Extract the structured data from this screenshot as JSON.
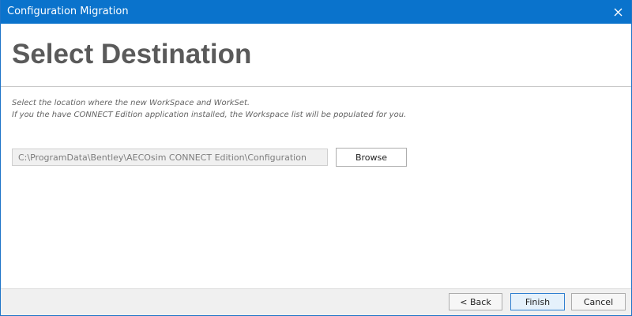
{
  "window": {
    "title": "Configuration Migration",
    "close_icon": "close-icon",
    "titlebar_color": "#0a73cc"
  },
  "header": {
    "title": "Select Destination"
  },
  "instructions": {
    "line1": "Select the location where the new WorkSpace and WorkSet.",
    "line2": "If you the have CONNECT Edition application installed, the Workspace list will be populated for you."
  },
  "destination": {
    "path_value": "C:\\ProgramData\\Bentley\\AECOsim CONNECT Edition\\Configuration",
    "browse_label": "Browse"
  },
  "footer": {
    "back_label": "< Back",
    "finish_label": "Finish",
    "cancel_label": "Cancel"
  }
}
